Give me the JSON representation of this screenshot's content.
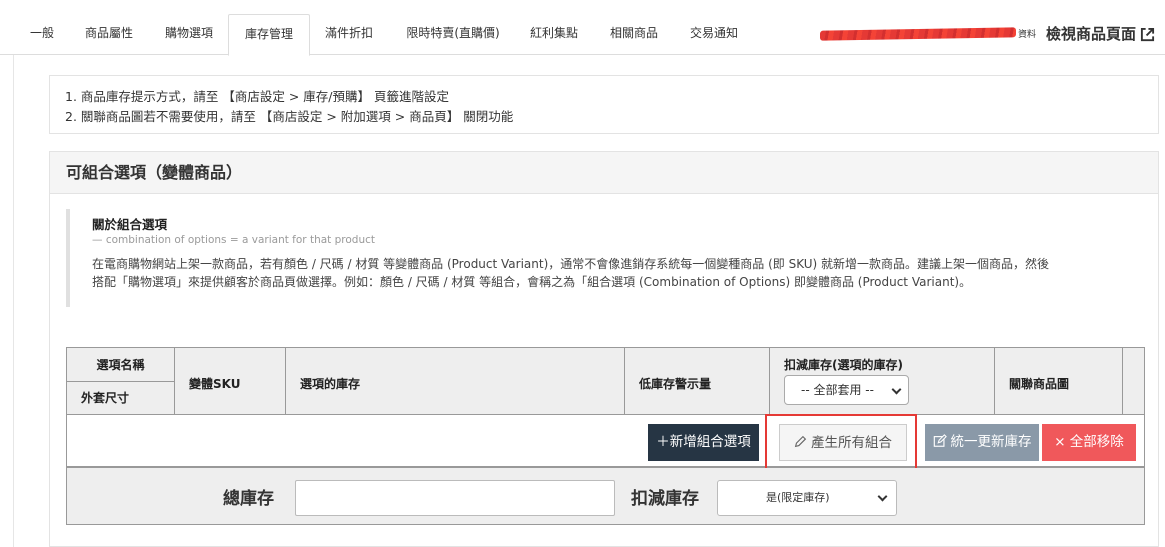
{
  "tabs": [
    {
      "label": "一般"
    },
    {
      "label": "商品屬性"
    },
    {
      "label": "購物選項"
    },
    {
      "label": "庫存管理",
      "active": true
    },
    {
      "label": "滿件折扣"
    },
    {
      "label": "限時特賣(直購價)"
    },
    {
      "label": "紅利集點"
    },
    {
      "label": "相關商品"
    },
    {
      "label": "交易通知"
    }
  ],
  "header": {
    "redacted_tail": "資料",
    "view_page_label": "檢視商品頁面"
  },
  "notice": {
    "line1": "1. 商品庫存提示方式，請至 【商店設定 > 庫存/預購】 頁籤進階設定",
    "line2": "2. 關聯商品圖若不需要使用，請至 【商店設定 > 附加選項 > 商品頁】 關閉功能"
  },
  "panel": {
    "title": "可組合選項（變體商品）",
    "about_title": "關於組合選項",
    "about_sub": "— combination of options = a variant for that product",
    "about_body_1": "在電商購物網站上架一款商品，若有顏色 / 尺碼 / 材質 等變體商品 (Product Variant)，通常不會像進銷存系統每一個變種商品 (即 SKU) 就新增一款商品。建議上架一個商品，然後",
    "about_body_2": "搭配「購物選項」來提供顧客於商品頁做選擇。例如：顏色 / 尺碼 / 材質 等組合，會稱之為「組合選項 (Combination of Options) 即變體商品 (Product Variant)。"
  },
  "table": {
    "col_option_name": "選項名稱",
    "col_option_sub": "外套尺寸",
    "col_sku": "變體SKU",
    "col_stock": "選項的庫存",
    "col_low_stock": "低庫存警示量",
    "col_deduct": "扣減庫存(選項的庫存)",
    "deduct_select_value": "-- 全部套用 --",
    "col_image": "關聯商品圖"
  },
  "actions": {
    "add_label": "＋新增組合選項",
    "generate_label": "產生所有組合",
    "update_label": "統一更新庫存",
    "remove_label": "× 全部移除"
  },
  "totals": {
    "total_label": "總庫存",
    "total_value": "",
    "deduct_label": "扣減庫存",
    "deduct_value": "是(限定庫存)"
  },
  "colors": {
    "highlight": "#e53935",
    "add_button": "#263544",
    "update_button": "#8a99a8",
    "remove_button": "#f0585b"
  }
}
